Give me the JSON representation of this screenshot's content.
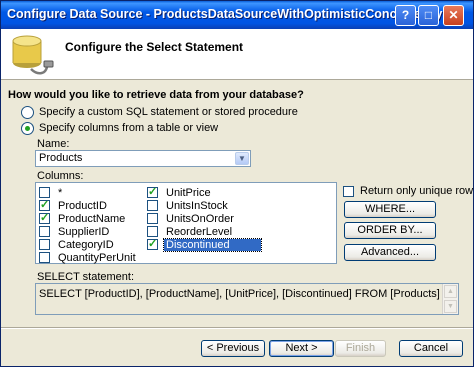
{
  "window": {
    "title": "Configure Data Source - ProductsDataSourceWithOptimisticConcurrency"
  },
  "header": {
    "title": "Configure the Select Statement",
    "icon": "database-icon"
  },
  "question": "How would you like to retrieve data from your database?",
  "options": [
    {
      "label": "Specify a custom SQL statement or stored procedure",
      "selected": false
    },
    {
      "label": "Specify columns from a table or view",
      "selected": true
    }
  ],
  "name_field": {
    "label": "Name:",
    "value": "Products"
  },
  "columns": {
    "label": "Columns:",
    "items": [
      {
        "name": "*",
        "checked": false
      },
      {
        "name": "ProductID",
        "checked": true
      },
      {
        "name": "ProductName",
        "checked": true
      },
      {
        "name": "SupplierID",
        "checked": false
      },
      {
        "name": "CategoryID",
        "checked": false
      },
      {
        "name": "QuantityPerUnit",
        "checked": false
      },
      {
        "name": "UnitPrice",
        "checked": true
      },
      {
        "name": "UnitsInStock",
        "checked": false
      },
      {
        "name": "UnitsOnOrder",
        "checked": false
      },
      {
        "name": "ReorderLevel",
        "checked": false
      },
      {
        "name": "Discontinued",
        "checked": true
      }
    ]
  },
  "unique_rows": {
    "label": "Return only unique rows",
    "checked": false
  },
  "side_buttons": {
    "where": "WHERE...",
    "order_by": "ORDER BY...",
    "advanced": "Advanced..."
  },
  "select_statement": {
    "label": "SELECT statement:",
    "value": "SELECT [ProductID], [ProductName], [UnitPrice], [Discontinued] FROM [Products]"
  },
  "footer": {
    "previous": "< Previous",
    "next": "Next >",
    "finish": "Finish",
    "cancel": "Cancel"
  }
}
